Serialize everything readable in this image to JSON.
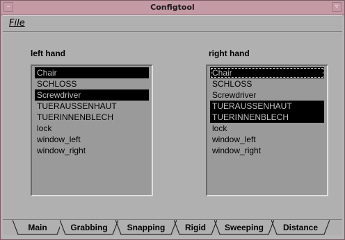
{
  "window": {
    "title": "Configtool"
  },
  "menubar": {
    "file_label": "File"
  },
  "left": {
    "label": "left hand",
    "items": [
      "Chair",
      "SCHLOSS",
      "Screwdriver",
      "TUERAUSSENHAUT",
      "TUERINNENBLECH",
      "lock",
      "window_left",
      "window_right"
    ],
    "selected": [
      0,
      2
    ]
  },
  "right": {
    "label": "right hand",
    "items": [
      "Chair",
      "SCHLOSS",
      "Screwdriver",
      "TUERAUSSENHAUT",
      "TUERINNENBLECH",
      "lock",
      "window_left",
      "window_right"
    ],
    "selected": [
      0,
      3,
      4
    ],
    "focused": 0
  },
  "tabs": [
    {
      "label": "Main"
    },
    {
      "label": "Grabbing"
    },
    {
      "label": "Snapping"
    },
    {
      "label": "Rigid"
    },
    {
      "label": "Sweeping"
    },
    {
      "label": "Distance"
    }
  ],
  "active_tab": "Grabbing"
}
